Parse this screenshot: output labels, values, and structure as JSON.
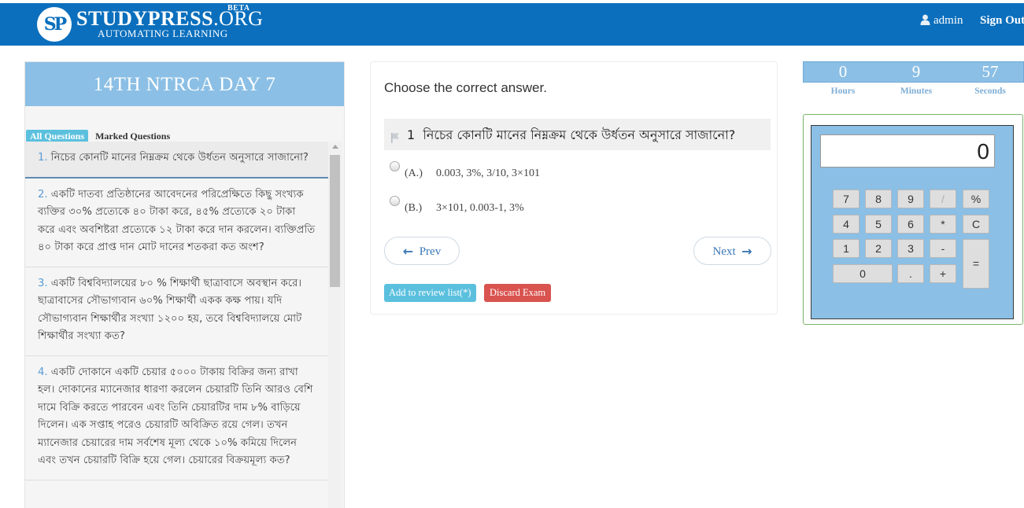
{
  "brand": {
    "logo_initials": "SP",
    "name_main": "STUDYPRESS",
    "name_tld": ".ORG",
    "beta": "BETA",
    "tagline": "AUTOMATING LEARNING"
  },
  "nav": {
    "user": "admin",
    "signout": "Sign Out"
  },
  "sidebar": {
    "title": "14TH NTRCA DAY 7",
    "tabs": {
      "all": "All Questions",
      "marked": "Marked Questions"
    },
    "questions": [
      {
        "num": "1.",
        "text": "নিচের কোনটি মানের নিম্নক্রম থেকে উর্ধতন অনুসারে সাজানো?"
      },
      {
        "num": "2.",
        "text": "একটি দাতব্য প্রতিষ্ঠানের আবেদনের পরিপ্রেক্ষিতে কিছু সংখ্যক ব্যক্তির ৩০% প্রত্যেকে ৪০ টাকা করে, ৪৫% প্রত্যেকে ২০ টাকা করে এবং অবশিষ্টরা প্রত্যেকে ১২ টাকা করে দান করলেন। ব্যক্তিপ্রতি ৪০ টাকা করে প্রাপ্ত দান মোট দানের শতকরা কত অংশ?"
      },
      {
        "num": "3.",
        "text": "একটি বিশ্ববিদ্যালয়ের ৮০ % শিক্ষার্থী ছাত্রাবাসে অবস্থান করে। ছাত্রাবাসের সৌভাগ্যবান ৬০% শিক্ষার্থী একক কক্ষ পায়। যদি সৌভাগ্যবান শিক্ষার্থীর সংখ্যা ১২০০ হয়, তবে বিশ্ববিদ্যালয়ে মোট শিক্ষার্থীর সংখ্যা কত?"
      },
      {
        "num": "4.",
        "text": "একটি দোকানে একটি চেয়ার ৫০০০ টাকায় বিক্রির জন্য রাখা হল। দোকানের ম্যানেজার ধারণা করলেন চেয়ারটি তিনি আরও বেশি দামে বিক্রি করতে পারবেন এবং তিনি চেয়ারটির দাম ৮% বাড়িয়ে দিলেন। এক সপ্তাহ পরেও চেয়ারটি অবিক্রিত রয়ে গেল। তখন ম্যানেজার চেয়ারের দাম সর্বশেষ মূল্য থেকে ১০% কমিয়ে দিলেন এবং তখন চেয়ারটি বিক্রি হয়ে গেল। চেয়ারের বিক্রয়মূল্য কত?"
      }
    ]
  },
  "exam": {
    "instruction": "Choose the correct answer.",
    "question_number": "1",
    "question_text": "নিচের কোনটি মানের নিম্নক্রম থেকে উর্ধতন অনুসারে সাজানো?",
    "options": [
      {
        "letter": "(A.)",
        "text": "0.003, 3%, 3/10, 3×101"
      },
      {
        "letter": "(B.)",
        "text": "3×101, 0.003-1, 3%"
      }
    ],
    "prev": "Prev",
    "next": "Next",
    "review": "Add to review list(*)",
    "discard": "Discard Exam"
  },
  "timer": {
    "hours": "0",
    "minutes": "9",
    "seconds": "57",
    "hours_label": "Hours",
    "minutes_label": "Minutes",
    "seconds_label": "Seconds"
  },
  "calculator": {
    "display": "0",
    "keys": {
      "k7": "7",
      "k8": "8",
      "k9": "9",
      "kdiv": "/",
      "kpct": "%",
      "k4": "4",
      "k5": "5",
      "k6": "6",
      "kmul": "*",
      "kc": "C",
      "k1": "1",
      "k2": "2",
      "k3": "3",
      "ksub": "-",
      "keq": "=",
      "k0": "0",
      "kdot": ".",
      "kadd": "+"
    }
  }
}
